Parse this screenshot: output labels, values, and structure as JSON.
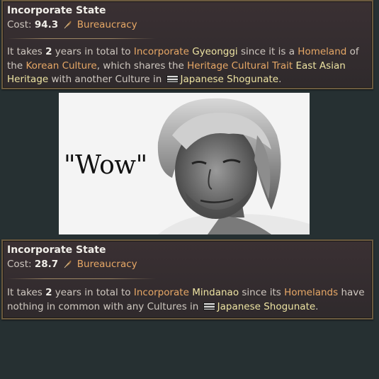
{
  "tooltip1": {
    "title": "Incorporate State",
    "cost_label": "Cost:",
    "cost_value": "94.3",
    "cost_resource": "Bureaucracy",
    "cost_icon": "feather-quill-icon",
    "body": {
      "t1": "It takes ",
      "years": "2",
      "t2": " years in total to ",
      "incorporate": "Incorporate",
      "state": "Gyeonggi",
      "t3": " since it is a ",
      "homeland": "Homeland",
      "t4": " of the ",
      "culture": "Korean Culture",
      "t5": ", which shares the ",
      "trait": "Heritage Cultural Trait",
      "heritage": "East Asian Heritage",
      "t6": " with another Culture in ",
      "country": "Japanese Shogunate",
      "t7": "."
    }
  },
  "image": {
    "caption": "\"Wow\""
  },
  "tooltip2": {
    "title": "Incorporate State",
    "cost_label": "Cost:",
    "cost_value": "28.7",
    "cost_resource": "Bureaucracy",
    "cost_icon": "feather-quill-icon",
    "body": {
      "t1": "It takes ",
      "years": "2",
      "t2": " years in total to ",
      "incorporate": "Incorporate",
      "state": "Mindanao",
      "t3": " since its ",
      "homelands": "Homelands",
      "t4": " have nothing in common with any Cultures in ",
      "country": "Japanese Shogunate",
      "t5": "."
    }
  },
  "colors": {
    "background": "#263032",
    "panel_border": "#6b5a3e",
    "orange_link": "#e7a866",
    "yellow_name": "#ede3a2",
    "text": "#cfc8c0"
  }
}
